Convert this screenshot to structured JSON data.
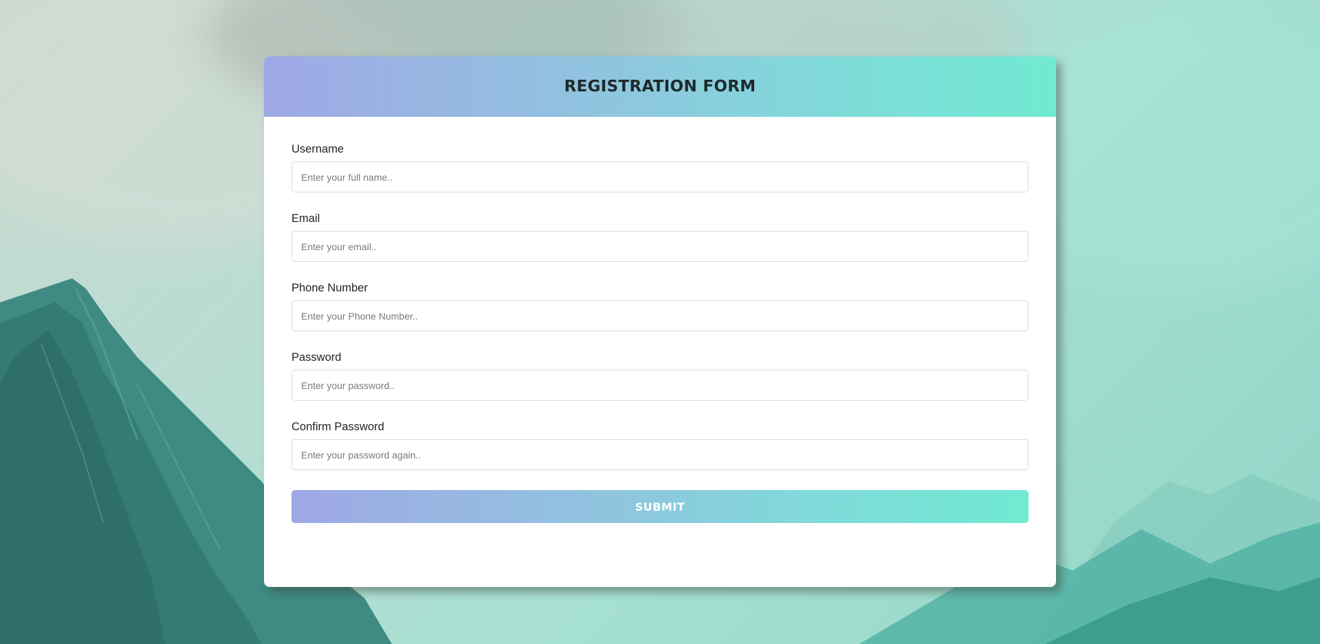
{
  "form": {
    "title": "REGISTRATION FORM",
    "fields": [
      {
        "label": "Username",
        "placeholder": "Enter your full name..",
        "value": ""
      },
      {
        "label": "Email",
        "placeholder": "Enter your email..",
        "value": ""
      },
      {
        "label": "Phone Number",
        "placeholder": "Enter your Phone Number..",
        "value": ""
      },
      {
        "label": "Password",
        "placeholder": "Enter your password..",
        "value": ""
      },
      {
        "label": "Confirm Password",
        "placeholder": "Enter your password again..",
        "value": ""
      }
    ],
    "submit_label": "SUBMIT"
  },
  "colors": {
    "gradient_start": "#9fa8e6",
    "gradient_end": "#70ead2",
    "card_background": "#ffffff",
    "title_text": "#1d2a2a"
  },
  "background": {
    "scene": "misty-teal-mountains"
  }
}
